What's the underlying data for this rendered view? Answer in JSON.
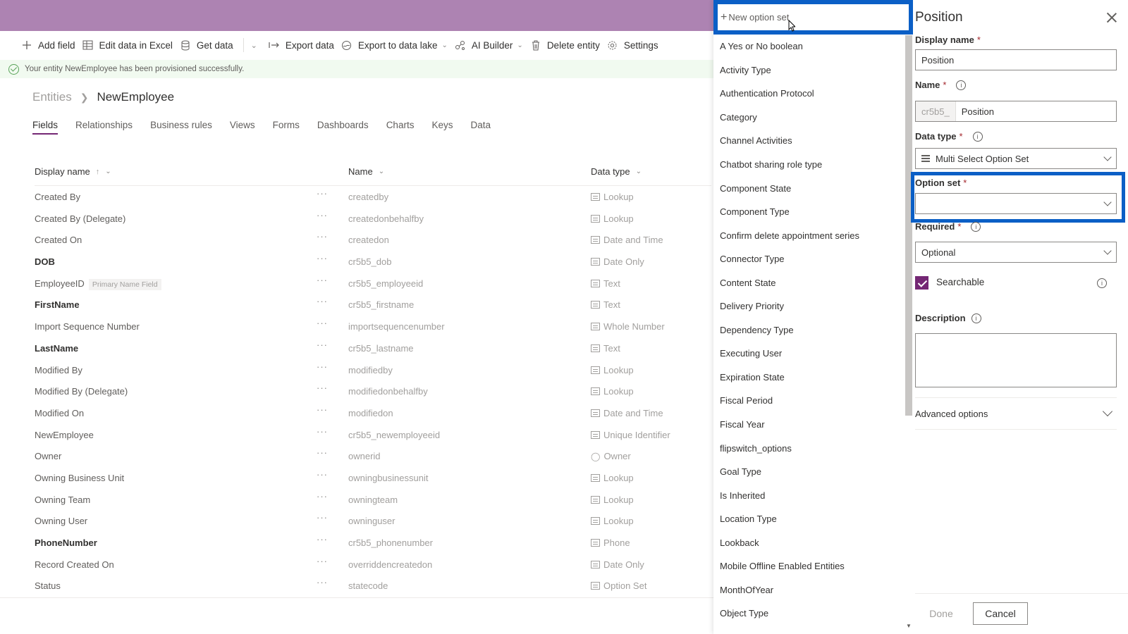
{
  "commands": {
    "add_field": "Add field",
    "edit_excel": "Edit data in Excel",
    "get_data": "Get data",
    "export_data": "Export data",
    "export_lake": "Export to data lake",
    "ai_builder": "AI Builder",
    "delete_entity": "Delete entity",
    "settings": "Settings"
  },
  "banner": "Your entity NewEmployee has been provisioned successfully.",
  "breadcrumb": {
    "root": "Entities",
    "current": "NewEmployee"
  },
  "tabs": [
    "Fields",
    "Relationships",
    "Business rules",
    "Views",
    "Forms",
    "Dashboards",
    "Charts",
    "Keys",
    "Data"
  ],
  "grid": {
    "col_display": "Display name",
    "col_name": "Name",
    "col_type": "Data type",
    "rows": [
      {
        "display": "Created By",
        "name": "createdby",
        "type": "Lookup",
        "bold": false
      },
      {
        "display": "Created By (Delegate)",
        "name": "createdonbehalfby",
        "type": "Lookup",
        "bold": false
      },
      {
        "display": "Created On",
        "name": "createdon",
        "type": "Date and Time",
        "bold": false
      },
      {
        "display": "DOB",
        "name": "cr5b5_dob",
        "type": "Date Only",
        "bold": true
      },
      {
        "display": "EmployeeID",
        "name": "cr5b5_employeeid",
        "type": "Text",
        "bold": false,
        "tag": "Primary Name Field"
      },
      {
        "display": "FirstName",
        "name": "cr5b5_firstname",
        "type": "Text",
        "bold": true
      },
      {
        "display": "Import Sequence Number",
        "name": "importsequencenumber",
        "type": "Whole Number",
        "bold": false
      },
      {
        "display": "LastName",
        "name": "cr5b5_lastname",
        "type": "Text",
        "bold": true
      },
      {
        "display": "Modified By",
        "name": "modifiedby",
        "type": "Lookup",
        "bold": false
      },
      {
        "display": "Modified By (Delegate)",
        "name": "modifiedonbehalfby",
        "type": "Lookup",
        "bold": false
      },
      {
        "display": "Modified On",
        "name": "modifiedon",
        "type": "Date and Time",
        "bold": false
      },
      {
        "display": "NewEmployee",
        "name": "cr5b5_newemployeeid",
        "type": "Unique Identifier",
        "bold": false
      },
      {
        "display": "Owner",
        "name": "ownerid",
        "type": "Owner",
        "bold": false
      },
      {
        "display": "Owning Business Unit",
        "name": "owningbusinessunit",
        "type": "Lookup",
        "bold": false
      },
      {
        "display": "Owning Team",
        "name": "owningteam",
        "type": "Lookup",
        "bold": false
      },
      {
        "display": "Owning User",
        "name": "owninguser",
        "type": "Lookup",
        "bold": false
      },
      {
        "display": "PhoneNumber",
        "name": "cr5b5_phonenumber",
        "type": "Phone",
        "bold": true
      },
      {
        "display": "Record Created On",
        "name": "overriddencreatedon",
        "type": "Date Only",
        "bold": false
      },
      {
        "display": "Status",
        "name": "statecode",
        "type": "Option Set",
        "bold": false
      }
    ]
  },
  "dropdown": {
    "new_option": "New option set",
    "items": [
      "A Yes or No boolean",
      "Activity Type",
      "Authentication Protocol",
      "Category",
      "Channel Activities",
      "Chatbot sharing role type",
      "Component State",
      "Component Type",
      "Confirm delete appointment series",
      "Connector Type",
      "Content State",
      "Delivery Priority",
      "Dependency Type",
      "Executing User",
      "Expiration State",
      "Fiscal Period",
      "Fiscal Year",
      "flipswitch_options",
      "Goal Type",
      "Is Inherited",
      "Location Type",
      "Lookback",
      "Mobile Offline Enabled Entities",
      "MonthOfYear",
      "Object Type"
    ]
  },
  "panel": {
    "title": "Position",
    "display_name_label": "Display name",
    "display_name_value": "Position",
    "name_label": "Name",
    "name_prefix": "cr5b5_",
    "name_value": "Position",
    "data_type_label": "Data type",
    "data_type_value": "Multi Select Option Set",
    "option_set_label": "Option set",
    "option_set_value": "",
    "required_label": "Required",
    "required_value": "Optional",
    "searchable_label": "Searchable",
    "description_label": "Description",
    "advanced_label": "Advanced options",
    "done_label": "Done",
    "cancel_label": "Cancel"
  },
  "colors": {
    "topbar": "#ad83b2",
    "accent": "#742774",
    "highlight": "#0b5fc6"
  }
}
